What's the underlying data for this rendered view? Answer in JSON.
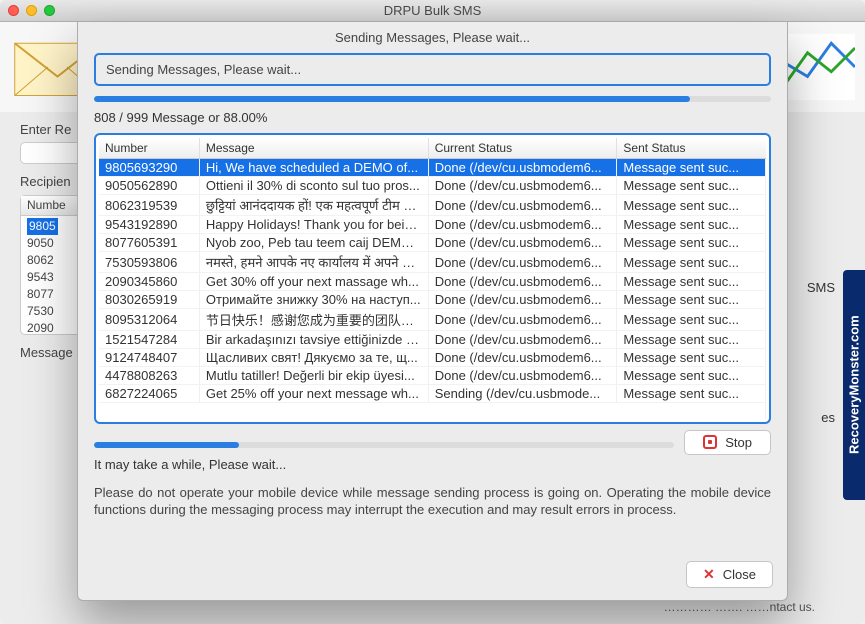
{
  "window": {
    "title": "DRPU Bulk SMS"
  },
  "bg": {
    "enter_label": "Enter Re",
    "recipients_label": "Recipien",
    "number_header": "Numbe",
    "numbers": [
      "9805",
      "9050",
      "8062",
      "9543",
      "8077",
      "7530",
      "2090"
    ],
    "message_label": "Message",
    "sms_label": "SMS",
    "es_label": "es",
    "help_text": "………… ……. ……ntact us."
  },
  "modal": {
    "title": "Sending Messages, Please wait...",
    "status": "Sending Messages, Please wait...",
    "progress_pct": 88,
    "count_text": "808 / 999 Message or 88.00%",
    "columns": {
      "number": "Number",
      "message": "Message",
      "current": "Current Status",
      "sent": "Sent Status"
    },
    "rows": [
      {
        "number": "9805693290",
        "message": "Hi, We have scheduled a DEMO of...",
        "current": "Done (/dev/cu.usbmodem6...",
        "sent": "Message sent suc...",
        "selected": true
      },
      {
        "number": "9050562890",
        "message": "Ottieni il 30% di sconto sul tuo pros...",
        "current": "Done (/dev/cu.usbmodem6...",
        "sent": "Message sent suc..."
      },
      {
        "number": "8062319539",
        "message": "छुट्टियां आनंददायक हों! एक महत्वपूर्ण टीम सद...",
        "current": "Done (/dev/cu.usbmodem6...",
        "sent": "Message sent suc..."
      },
      {
        "number": "9543192890",
        "message": "Happy Holidays! Thank you for bein...",
        "current": "Done (/dev/cu.usbmodem6...",
        "sent": "Message sent suc..."
      },
      {
        "number": "8077605391",
        "message": "Nyob zoo, Peb tau teem caij DEMO...",
        "current": "Done (/dev/cu.usbmodem6...",
        "sent": "Message sent suc..."
      },
      {
        "number": "7530593806",
        "message": "नमस्ते, हमने आपके नए कार्यालय में अपने नए...",
        "current": "Done (/dev/cu.usbmodem6...",
        "sent": "Message sent suc..."
      },
      {
        "number": "2090345860",
        "message": "Get 30% off your next massage wh...",
        "current": "Done (/dev/cu.usbmodem6...",
        "sent": "Message sent suc..."
      },
      {
        "number": "8030265919",
        "message": "Отримайте знижку 30% на наступ...",
        "current": "Done (/dev/cu.usbmodem6...",
        "sent": "Message sent suc..."
      },
      {
        "number": "8095312064",
        "message": "节日快乐！感谢您成为重要的团队成...",
        "current": "Done (/dev/cu.usbmodem6...",
        "sent": "Message sent suc..."
      },
      {
        "number": "1521547284",
        "message": "Bir arkadaşınızı tavsiye ettiğinizde b...",
        "current": "Done (/dev/cu.usbmodem6...",
        "sent": "Message sent suc..."
      },
      {
        "number": "9124748407",
        "message": "Щасливих свят! Дякуємо за те, щ...",
        "current": "Done (/dev/cu.usbmodem6...",
        "sent": "Message sent suc..."
      },
      {
        "number": "4478808263",
        "message": "Mutlu tatiller! Değerli bir ekip üyesi...",
        "current": "Done (/dev/cu.usbmodem6...",
        "sent": "Message sent suc..."
      },
      {
        "number": "6827224065",
        "message": "Get 25% off your next message wh...",
        "current": "Sending (/dev/cu.usbmode...",
        "sent": "Message sent suc..."
      }
    ],
    "wait_text": "It may take a while, Please wait...",
    "notice": "Please do not operate your mobile device while message sending process is going on. Operating the mobile device functions during the messaging process may interrupt the execution and may result errors in process.",
    "stop_label": "Stop",
    "close_label": "Close"
  },
  "ribbon": "RecoveryMonster.com"
}
